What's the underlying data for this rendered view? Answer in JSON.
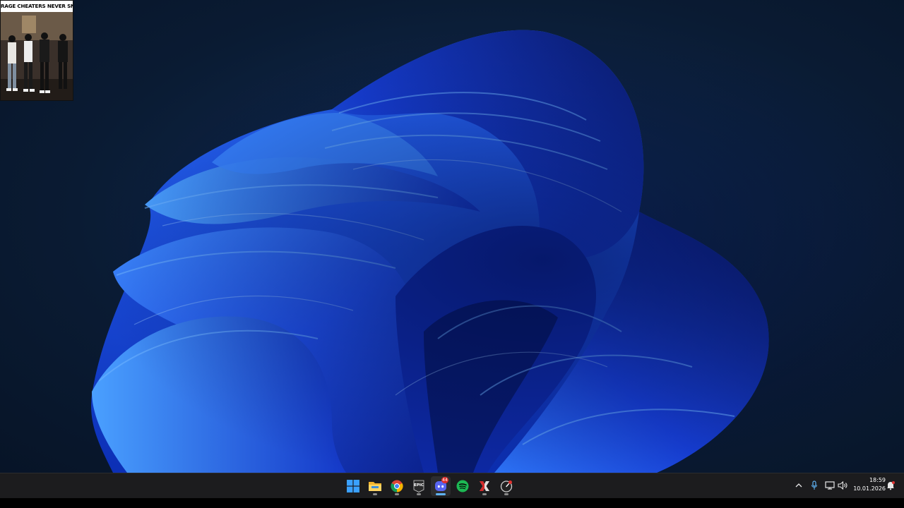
{
  "overlay": {
    "caption": "RAGE CHEATERS NEVER SNITCH"
  },
  "taskbar": {
    "icons": [
      {
        "name": "start-button",
        "icon": "windows-logo-icon",
        "running": false
      },
      {
        "name": "file-explorer",
        "icon": "folder-icon",
        "running": true
      },
      {
        "name": "chrome",
        "icon": "chrome-icon",
        "running": true
      },
      {
        "name": "epic-games",
        "icon": "epic-games-icon",
        "label": "EPIC",
        "running": true
      },
      {
        "name": "discord",
        "icon": "discord-icon",
        "badge": "44",
        "running": true,
        "active": true
      },
      {
        "name": "spotify",
        "icon": "spotify-icon",
        "running": true
      },
      {
        "name": "red-x-app",
        "icon": "red-x-icon",
        "running": true
      },
      {
        "name": "settings-app",
        "icon": "gauge-icon",
        "running": true
      }
    ],
    "tray": {
      "clock_time": "18:59",
      "clock_date": "10.01.2026"
    }
  },
  "colors": {
    "accent_blue": "#2f6bff",
    "discord": "#5865f2",
    "spotify": "#1db954",
    "active_indicator": "#5fb2f2"
  }
}
